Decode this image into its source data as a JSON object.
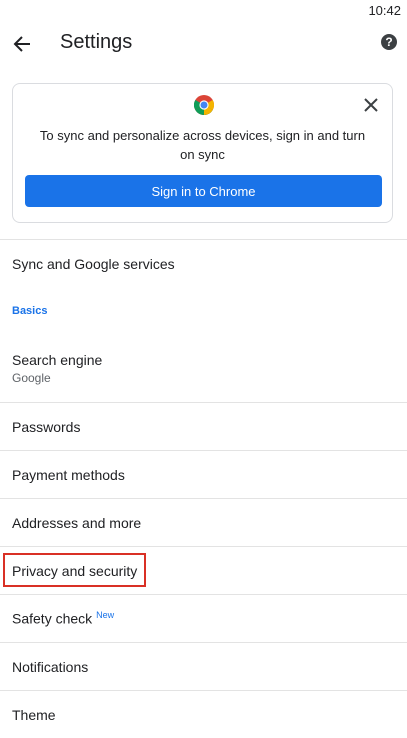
{
  "status_bar": {
    "time": "10:42"
  },
  "app_bar": {
    "title": "Settings",
    "help_label": "?"
  },
  "promo": {
    "message": "To sync and personalize across devices, sign in and turn on sync",
    "signin_label": "Sign in to Chrome"
  },
  "list": {
    "sync": "Sync and Google services",
    "basics_header": "Basics",
    "search_engine": {
      "title": "Search engine",
      "value": "Google"
    },
    "passwords": "Passwords",
    "payment_methods": "Payment methods",
    "addresses": "Addresses and more",
    "privacy": "Privacy and security",
    "safety_check": {
      "title": "Safety check",
      "badge": "New"
    },
    "notifications": "Notifications",
    "theme": "Theme"
  },
  "colors": {
    "accent": "#1a73e8",
    "highlight": "#d93025"
  }
}
